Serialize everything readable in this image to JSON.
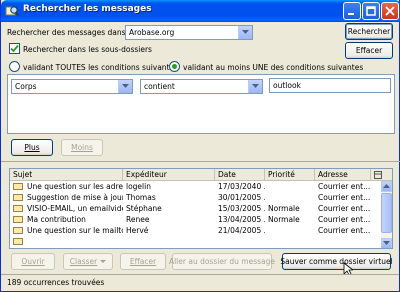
{
  "window": {
    "title": "Rechercher les messages"
  },
  "search_in": {
    "label": "Rechercher des messages dans :",
    "value": "Arobase.org"
  },
  "buttons": {
    "search": "Rechercher",
    "clear": "Effacer",
    "more": "Plus",
    "fewer": "Moins",
    "open": "Ouvrir",
    "file": "Classer",
    "delete": "Effacer",
    "goto_folder": "Aller au dossier du message",
    "save_virtual": "Sauver comme dossier virtuel"
  },
  "subfolders": {
    "label": "Rechercher dans les sous-dossiers",
    "checked": true
  },
  "match": {
    "all_label": "validant TOUTES les conditions suivantes",
    "any_label": "validant au moins UNE des conditions suivantes",
    "selected": "any"
  },
  "criteria": {
    "field": "Corps",
    "operator": "contient",
    "value": "outlook"
  },
  "table": {
    "columns": [
      "Sujet",
      "Expéditeur",
      "Date",
      "Priorité",
      "Adresse"
    ],
    "rows": [
      [
        "Une question sur les adres...",
        "logelin",
        "17/03/2040 ...",
        "",
        "Courrier ent..."
      ],
      [
        "Suggestion de mise à jour",
        "Thomas",
        "30/01/2005 ...",
        "",
        "Courrier ent..."
      ],
      [
        "VISIO-EMAIL, un emailvidé...",
        "Stéphane",
        "15/03/2005 ...",
        "Normale",
        "Courrier ent..."
      ],
      [
        "Ma contribution",
        "Renee",
        "13/04/2005 ...",
        "Normale",
        "Courrier ent..."
      ],
      [
        "Une question sur le mailto",
        "Hervé",
        "21/04/2005 ...",
        "",
        "Courrier ent..."
      ],
      [
        "",
        "",
        "",
        "",
        ""
      ]
    ]
  },
  "status": {
    "text": "189 occurrences trouvées"
  }
}
